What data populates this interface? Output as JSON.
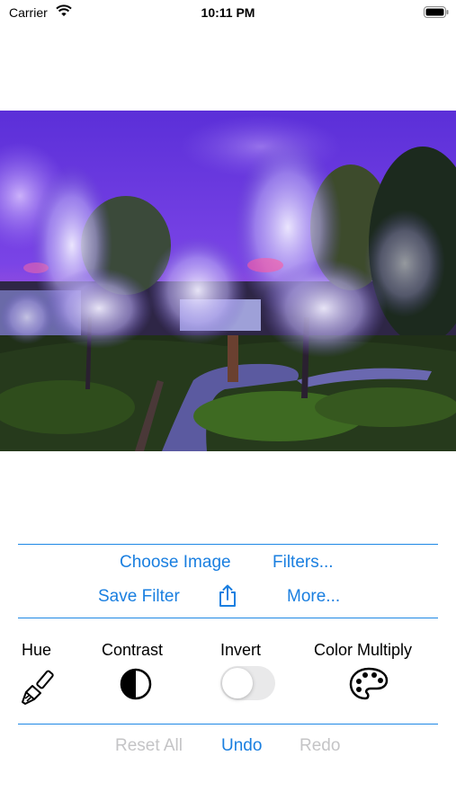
{
  "status_bar": {
    "carrier": "Carrier",
    "time": "10:11 PM"
  },
  "image": {
    "icon": "garden-photo"
  },
  "actions": {
    "choose_image": "Choose Image",
    "filters": "Filters...",
    "save_filter": "Save Filter",
    "share_icon": "share-icon",
    "more": "More..."
  },
  "filters": {
    "hue": {
      "label": "Hue",
      "icon": "paintbrush-icon"
    },
    "contrast": {
      "label": "Contrast",
      "icon": "contrast-icon"
    },
    "invert": {
      "label": "Invert",
      "enabled": false
    },
    "color_multiply": {
      "label": "Color Multiply",
      "icon": "palette-icon"
    }
  },
  "history": {
    "reset_all": "Reset All",
    "undo": "Undo",
    "redo": "Redo"
  },
  "colors": {
    "accent": "#1a7fe0",
    "disabled": "#c4c4c6",
    "divider": "#1e88e5"
  }
}
